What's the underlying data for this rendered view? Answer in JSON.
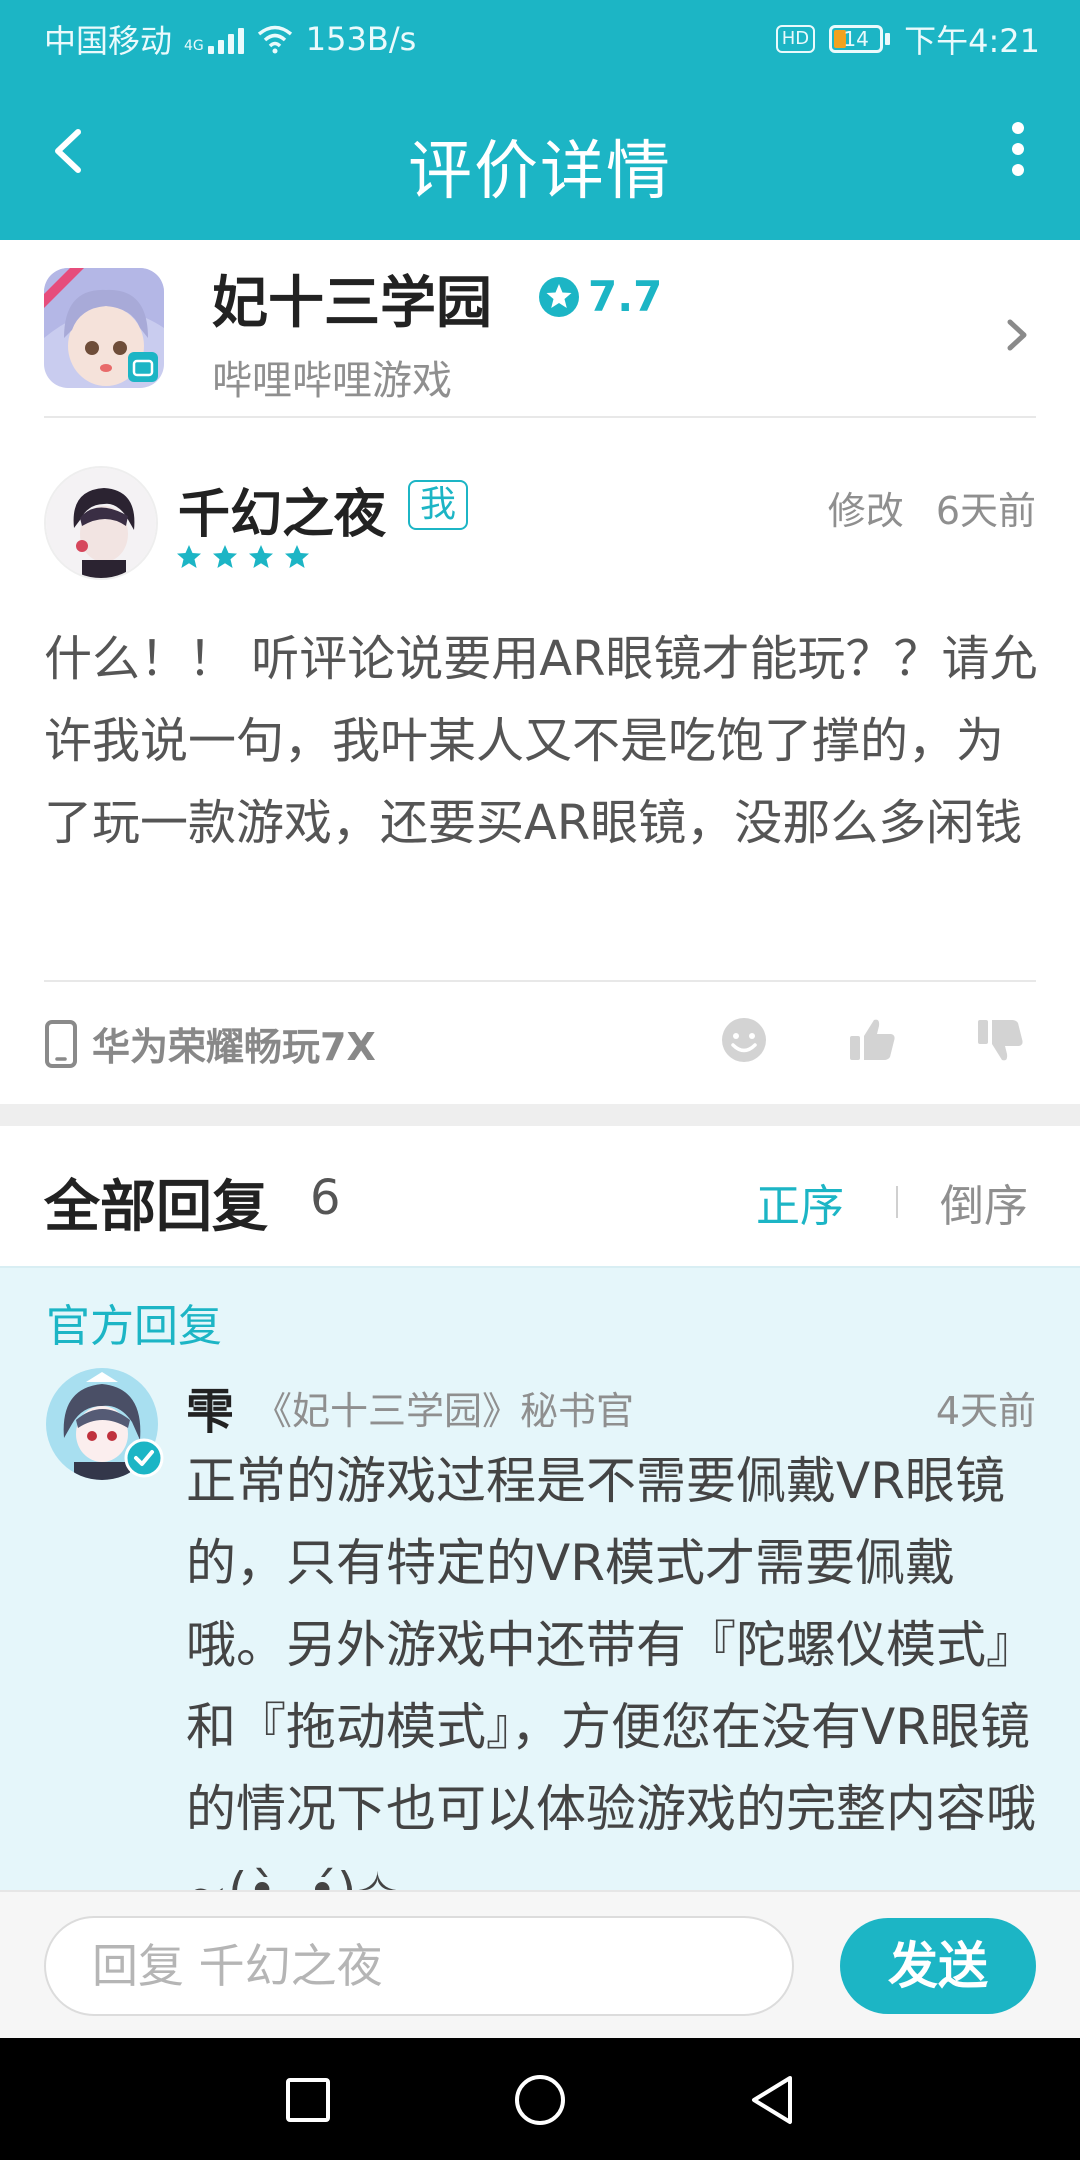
{
  "status_bar": {
    "carrier": "中国移动",
    "net_type": "4G",
    "speed": "153B/s",
    "hd": "HD",
    "battery": "14",
    "time": "下午4:21"
  },
  "app_bar": {
    "title": "评价详情"
  },
  "game": {
    "name": "妃十三学园",
    "rating": "7.7",
    "publisher": "哔哩哔哩游戏",
    "icon_tag": "VR适配"
  },
  "review": {
    "username": "千幻之夜",
    "badge": "我",
    "stars": 4,
    "edit_label": "修改",
    "time": "6天前",
    "text": "什么！！ 听评论说要用AR眼镜才能玩？？请允许我说一句，我叶某人又不是吃饱了撑的，为了玩一款游戏，还要买AR眼镜，没那么多闲钱",
    "device": "华为荣耀畅玩7X"
  },
  "replies": {
    "title": "全部回复",
    "count": "6",
    "sort_asc": "正序",
    "sort_desc": "倒序"
  },
  "official_reply": {
    "label": "官方回复",
    "name": "雫",
    "role": "《妃十三学园》秘书官",
    "time": "4天前",
    "text": "正常的游戏过程是不需要佩戴VR眼镜的，只有特定的VR模式才需要佩戴哦。另外游戏中还带有『陀螺仪模式』和『拖动模式』，方便您在没有VR眼镜的情况下也可以体验游戏的完整内容哦~(•̀ᴗ•́)✧"
  },
  "reply_bar": {
    "placeholder": "回复 千幻之夜",
    "send_label": "发送"
  },
  "colors": {
    "accent": "#1cb5c5",
    "official_bg": "#e5f6fa",
    "text_gray": "#8f8f8f",
    "battery_low": "#f1a21f"
  },
  "icons": [
    "back-arrow-icon",
    "more-vertical-icon",
    "star-icon",
    "chevron-right-icon",
    "phone-icon",
    "smiley-icon",
    "thumbs-up-icon",
    "thumbs-down-icon",
    "verified-icon",
    "nav-recents-icon",
    "nav-home-icon",
    "nav-back-icon"
  ]
}
